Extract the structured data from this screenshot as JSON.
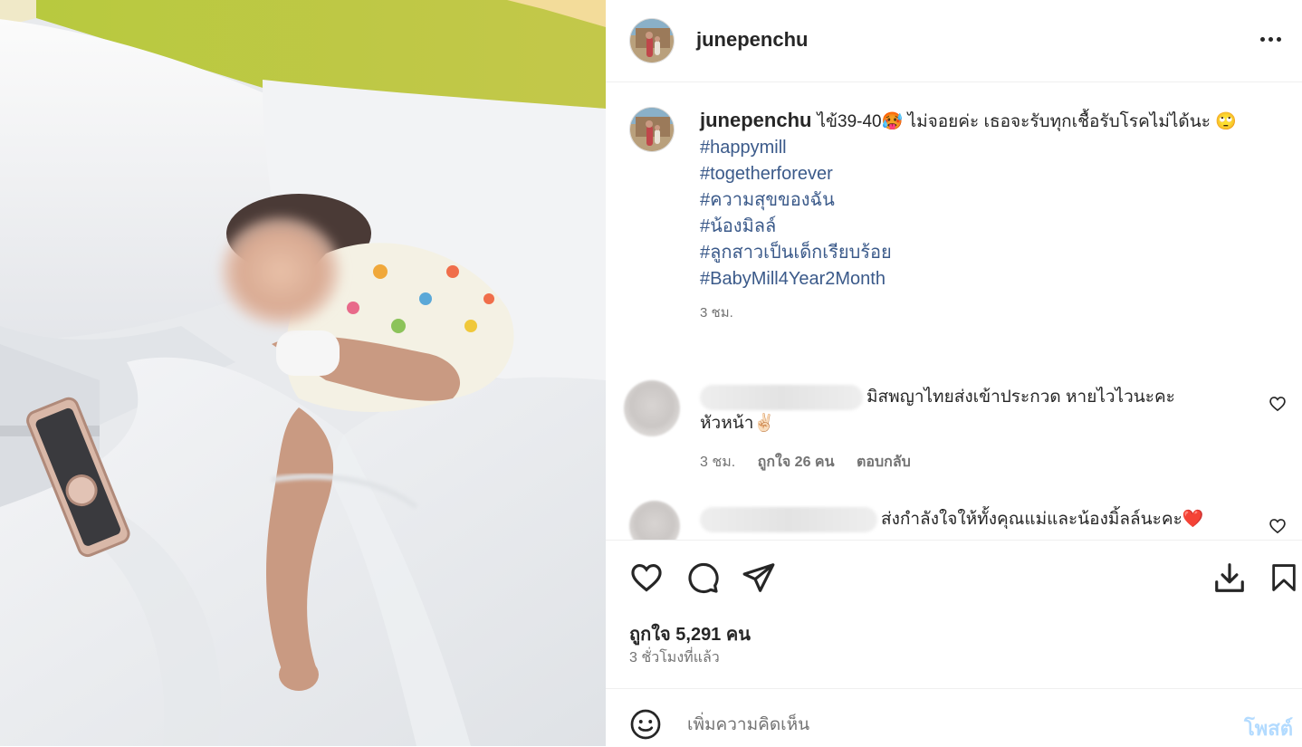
{
  "post": {
    "username": "junepenchu",
    "more_icon": "more-horizontal-icon"
  },
  "caption": {
    "username": "junepenchu",
    "text": "ไข้39-40🥵 ไม่จอยค่ะ เธอจะรับทุกเชื้อรับโรคไม่ได้นะ 🙄",
    "hashtags": [
      "#happymill",
      "#togetherforever",
      "#ความสุขของฉัน",
      "#น้องมิลล์",
      "#ลูกสาวเป็นเด็กเรียบร้อย",
      "#BabyMill4Year2Month"
    ],
    "time": "3 ชม."
  },
  "comments": [
    {
      "text": "มิสพญาไทยส่งเข้าประกวด หายไวไวนะคะ หัวหน้า✌🏻",
      "time": "3 ชม.",
      "likes": "ถูกใจ 26 คน",
      "reply": "ตอบกลับ"
    },
    {
      "text": "ส่งกำลังใจให้ทั้งคุณแม่และน้องมิ้ลล์นะคะ❤️"
    }
  ],
  "actions": {
    "like_icon": "heart-icon",
    "comment_icon": "comment-icon",
    "share_icon": "send-icon",
    "download_icon": "download-icon",
    "save_icon": "bookmark-icon"
  },
  "likes_text": "ถูกใจ 5,291 คน",
  "posted_ago": "3 ชั่วโมงที่แล้ว",
  "add_comment": {
    "placeholder": "เพิ่มความคิดเห็น",
    "post_label": "โพสต์",
    "emoji_icon": "smiley-icon"
  },
  "colors": {
    "hashtag": "#3b5a8a",
    "muted": "#737373",
    "post_disabled": "#b3dbff"
  }
}
